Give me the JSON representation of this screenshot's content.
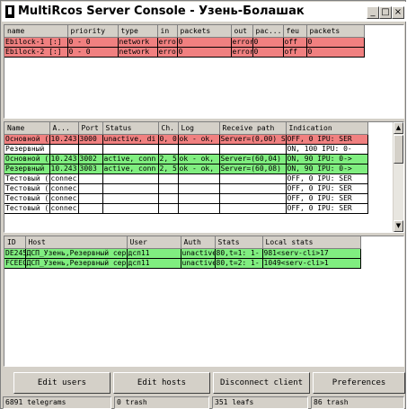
{
  "window": {
    "title": "MultiRcos Server Console - Узень-Болашак",
    "controls": {
      "minimize": "_",
      "maximize": "□",
      "close": "×"
    }
  },
  "blocks_table": {
    "columns": [
      "name",
      "priority",
      "type",
      "in",
      "packets",
      "out",
      "pac...",
      "feu",
      "packets"
    ],
    "rows": [
      {
        "status": "red",
        "cells": [
          "Ebilock-1 [:]",
          "0 - 0",
          "network",
          "error",
          "0",
          "error",
          "0",
          "off",
          "0"
        ]
      },
      {
        "status": "red",
        "cells": [
          "Ebilock-2 [:]",
          "0 - 0",
          "network",
          "error",
          "0",
          "error",
          "0",
          "off",
          "0"
        ]
      }
    ]
  },
  "servers_table": {
    "columns": [
      "Name",
      "A...",
      "Port",
      "Status",
      "Ch.",
      "Log",
      "Receive path",
      "Indication"
    ],
    "rows": [
      {
        "status": "red",
        "cells": [
          "Основной (",
          "10.243",
          "3000",
          "unactive, di",
          "0, 0",
          "ok - ok,",
          "Server=(0,00) S",
          "OFF, 0 IPU: SER"
        ]
      },
      {
        "status": "white",
        "cells": [
          "Резервный",
          "",
          "",
          "",
          "",
          "",
          "",
          "ON, 100 IPU: 0-"
        ]
      },
      {
        "status": "green",
        "cells": [
          "Основной (",
          "10.243",
          "3002",
          "active, conn",
          "2, 5",
          "ok - ok,",
          "Server=(60,04)",
          "ON, 90 IPU: 0->"
        ]
      },
      {
        "status": "green",
        "cells": [
          "Резервный",
          "10.243",
          "3003",
          "active, conn",
          "2, 5",
          "ok - ok,",
          "Server=(60,08)",
          "ON, 90 IPU: 0->"
        ]
      },
      {
        "status": "white",
        "cells": [
          "Тестовый (",
          "connec",
          "",
          "",
          "",
          "",
          "",
          "OFF, 0 IPU: SER"
        ]
      },
      {
        "status": "white",
        "cells": [
          "Тестовый (",
          "connec",
          "",
          "",
          "",
          "",
          "",
          "OFF, 0 IPU: SER"
        ]
      },
      {
        "status": "white",
        "cells": [
          "Тестовый (",
          "connec",
          "",
          "",
          "",
          "",
          "",
          "OFF, 0 IPU: SER"
        ]
      },
      {
        "status": "white",
        "cells": [
          "Тестовый (",
          "connec",
          "",
          "",
          "",
          "",
          "",
          "OFF, 0 IPU: SER"
        ]
      }
    ]
  },
  "clients_table": {
    "columns": [
      "ID",
      "Host",
      "User",
      "Auth",
      "Stats",
      "Local stats"
    ],
    "rows": [
      {
        "status": "green",
        "cells": [
          "DE245",
          "ДСП_Узень,Резервный сервер",
          "дсп11",
          "unactive",
          "80,t=1: 1-",
          "981<serv-cli>17"
        ]
      },
      {
        "status": "green",
        "cells": [
          "FCEEC",
          "ДСП_Узень,Резервный сервер",
          "дсп11",
          "unactive",
          "80,t=2: 1-",
          "1049<serv-cli>1"
        ]
      }
    ]
  },
  "buttons": {
    "edit_users": "Edit users",
    "edit_hosts": "Edit hosts",
    "disconnect_client": "Disconnect client",
    "preferences": "Preferences"
  },
  "status_bar": {
    "telegrams": "6891 telegrams",
    "trash_1": "0 trash",
    "leafs": "351 leafs",
    "trash_2": "86 trash"
  },
  "colors": {
    "error_row": "#f08080",
    "active_row": "#80ee80",
    "window_bg": "#d4d0c8"
  },
  "icons": {
    "scroll_up": "up-arrow-icon",
    "scroll_down": "down-arrow-icon",
    "app": "app-icon"
  }
}
